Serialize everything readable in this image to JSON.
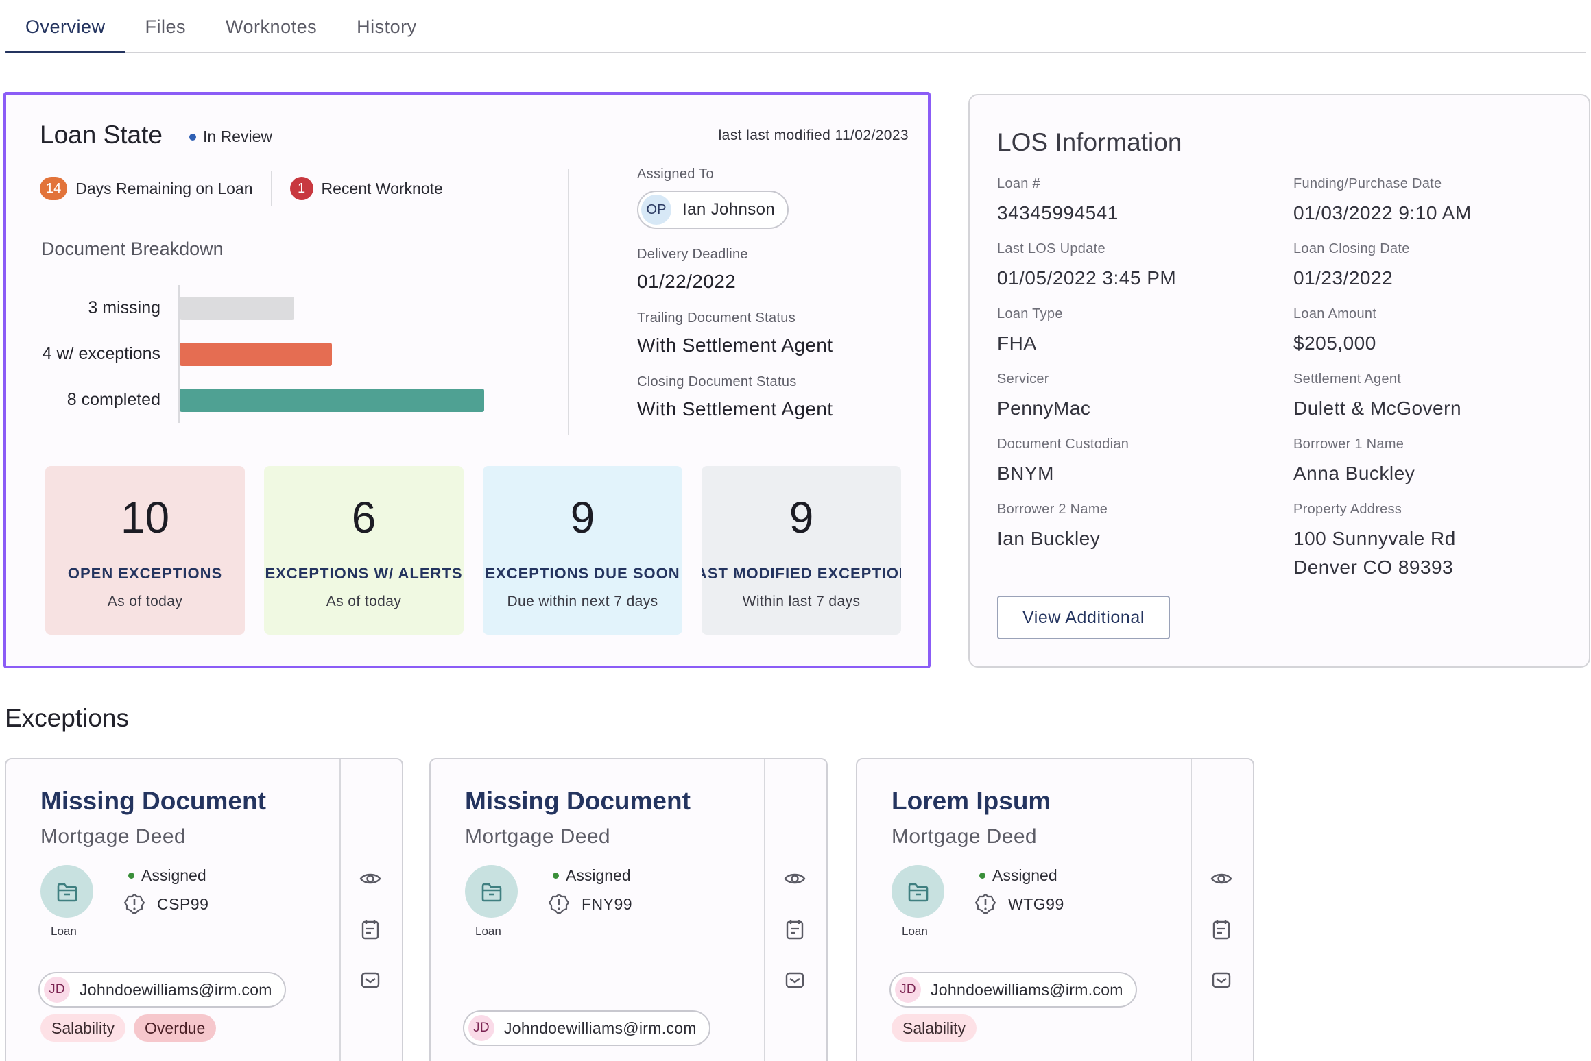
{
  "tabs": [
    {
      "label": "Overview",
      "active": true
    },
    {
      "label": "Files",
      "active": false
    },
    {
      "label": "Worknotes",
      "active": false
    },
    {
      "label": "History",
      "active": false
    }
  ],
  "loan_state": {
    "title": "Loan State",
    "status": "In Review",
    "status_color": "#2f5fb3",
    "last_modified": "last last modified 11/02/2023",
    "days_remaining_count": "14",
    "days_remaining_label": "Days Remaining on Loan",
    "worknote_count": "1",
    "worknote_label": "Recent Worknote",
    "breakdown_title": "Document Breakdown",
    "breakdown": [
      {
        "label": "3 missing",
        "value": 3,
        "color": "#dcdcde"
      },
      {
        "label": "4 w/ exceptions",
        "value": 4,
        "color": "#e56d52"
      },
      {
        "label": "8 completed",
        "value": 8,
        "color": "#4fa193"
      }
    ],
    "assigned_to_label": "Assigned To",
    "assigned_initials": "OP",
    "assigned_name": "Ian Johnson",
    "delivery_deadline_label": "Delivery Deadline",
    "delivery_deadline": "01/22/2022",
    "trailing_status_label": "Trailing Document Status",
    "trailing_status": "With Settlement Agent",
    "closing_status_label": "Closing Document Status",
    "closing_status": "With Settlement Agent",
    "stats": [
      {
        "number": "10",
        "label": "OPEN EXCEPTIONS",
        "sub": "As of today",
        "bg": "#f7e2e2"
      },
      {
        "number": "6",
        "label": "EXCEPTIONS W/ ALERTS",
        "sub": "As of today",
        "bg": "#f0f9e2"
      },
      {
        "number": "9",
        "label": "EXCEPTIONS DUE SOON",
        "sub": "Due within next 7 days",
        "bg": "#e2f3fb"
      },
      {
        "number": "9",
        "label": "AST MODIFIED EXCEPTION",
        "sub": "Within last 7 days",
        "bg": "#edeff2"
      }
    ]
  },
  "los": {
    "title": "LOS Information",
    "items": [
      {
        "label": "Loan #",
        "value": "34345994541"
      },
      {
        "label": "Funding/Purchase Date",
        "value": "01/03/2022 9:10 AM"
      },
      {
        "label": "Last LOS Update",
        "value": "01/05/2022 3:45 PM"
      },
      {
        "label": "Loan Closing Date",
        "value": "01/23/2022"
      },
      {
        "label": "Loan Type",
        "value": "FHA"
      },
      {
        "label": "Loan Amount",
        "value": "$205,000"
      },
      {
        "label": "Servicer",
        "value": "PennyMac"
      },
      {
        "label": "Settlement Agent",
        "value": "Dulett & McGovern"
      },
      {
        "label": "Document Custodian",
        "value": "BNYM"
      },
      {
        "label": "Borrower 1 Name",
        "value": "Anna Buckley"
      },
      {
        "label": "Borrower 2 Name",
        "value": "Ian Buckley"
      },
      {
        "label": "Property Address",
        "value": "100 Sunnyvale Rd",
        "value2": "Denver CO 89393"
      }
    ],
    "view_button": "View Additional"
  },
  "exceptions": {
    "title": "Exceptions",
    "cards": [
      {
        "name": "Missing Document",
        "doc": "Mortgage Deed",
        "status": "Assigned",
        "code": "CSP99",
        "loan_caption": "Loan",
        "initials": "JD",
        "email": "Johndoewilliams@irm.com",
        "tags": [
          "Salability",
          "Overdue"
        ]
      },
      {
        "name": "Missing Document",
        "doc": "Mortgage Deed",
        "status": "Assigned",
        "code": "FNY99",
        "loan_caption": "Loan",
        "initials": "JD",
        "email": "Johndoewilliams@irm.com",
        "tags": []
      },
      {
        "name": "Lorem Ipsum",
        "doc": "Mortgage Deed",
        "status": "Assigned",
        "code": "WTG99",
        "loan_caption": "Loan",
        "initials": "JD",
        "email": "Johndoewilliams@irm.com",
        "tags": [
          "Salability"
        ]
      }
    ]
  },
  "colors": {
    "accent": "#24345f",
    "selection_border": "#8b5cf6",
    "assigned_dot": "#3a8f3a",
    "days_badge": "#e2733a",
    "worknote_badge": "#c8383f"
  },
  "icons": {
    "view": "eye-icon",
    "notes": "notepad-icon",
    "message": "envelope-icon",
    "loan": "folder-icon",
    "alert": "alert-badge-icon"
  }
}
